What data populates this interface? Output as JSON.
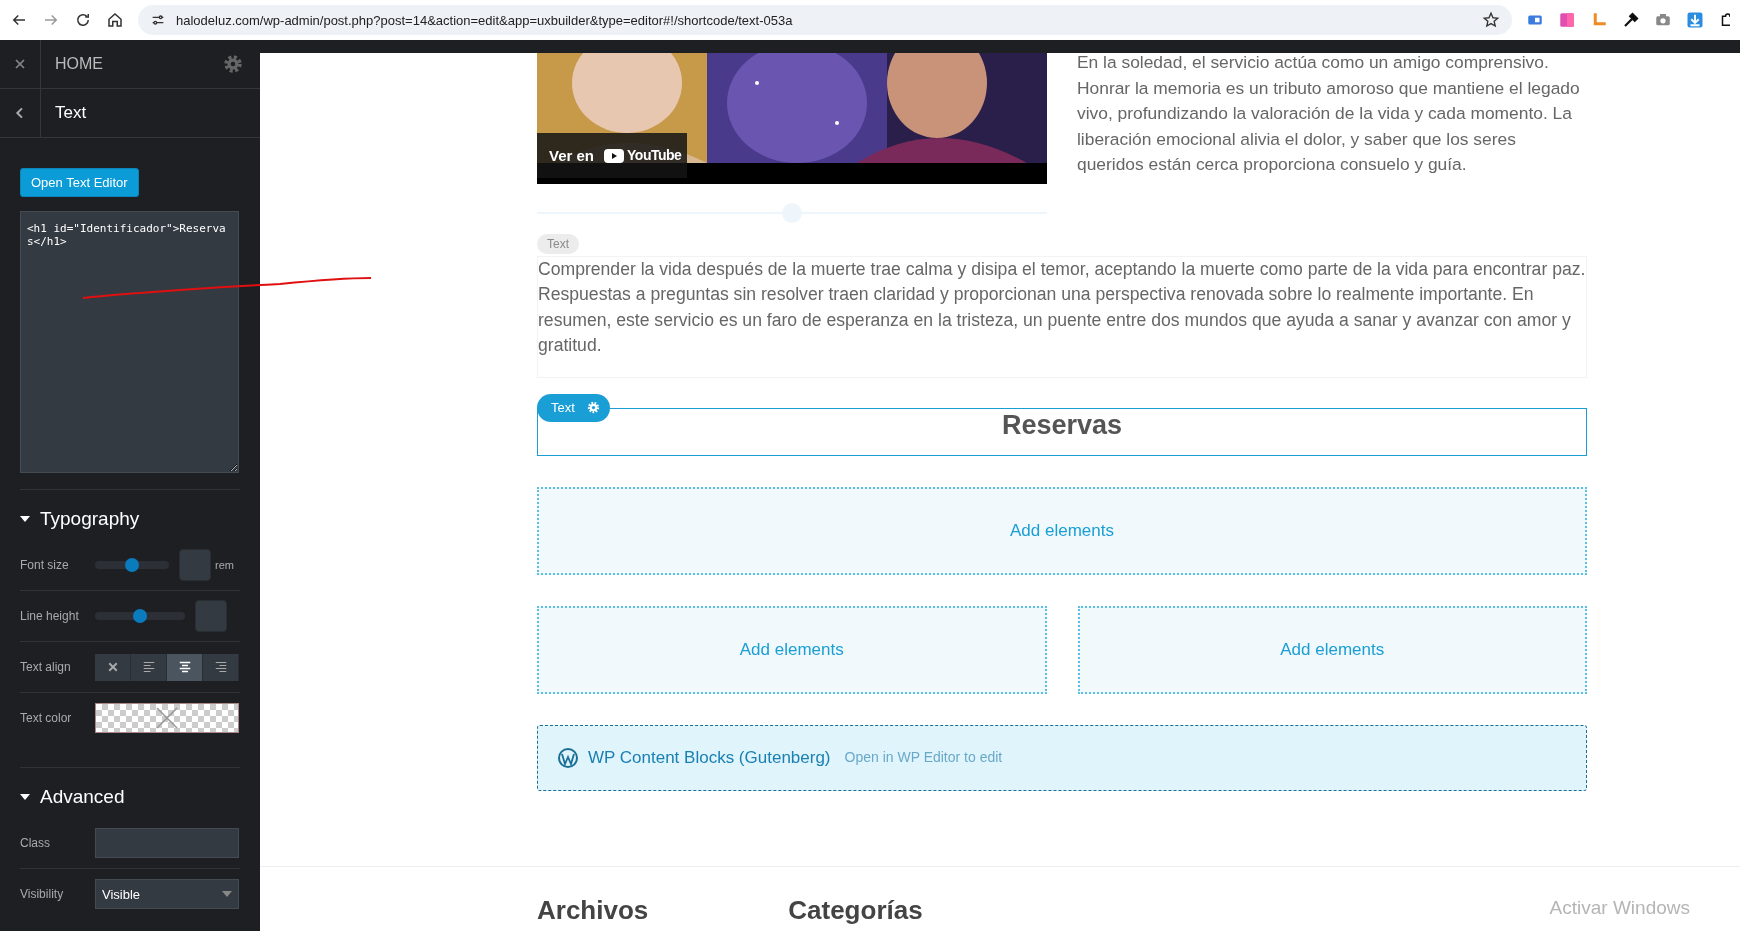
{
  "browser": {
    "url": "halodeluz.com/wp-admin/post.php?post=14&action=edit&app=uxbuilder&type=editor#!/shortcode/text-053a"
  },
  "sidebar": {
    "header_title": "HOME",
    "panel_title": "Text",
    "open_editor_button": "Open Text Editor",
    "code": "<h1 id=\"Identificador\">Reservas</h1>",
    "typography": {
      "title": "Typography",
      "expanded": true,
      "font_size": {
        "label": "Font size",
        "level": 0.5,
        "unit": "rem"
      },
      "line_height": {
        "label": "Line height",
        "level": 0.5
      },
      "text_align": {
        "label": "Text align",
        "options": [
          {
            "kind": "none",
            "selected": false
          },
          {
            "kind": "left",
            "selected": false
          },
          {
            "kind": "center",
            "selected": true
          },
          {
            "kind": "right",
            "selected": false
          }
        ]
      },
      "text_color": {
        "label": "Text color"
      }
    },
    "advanced": {
      "title": "Advanced",
      "expanded": true,
      "class_label": "Class",
      "visibility": {
        "label": "Visibility",
        "value": "Visible"
      }
    }
  },
  "content": {
    "video": {
      "watch_label": "Ver en",
      "logo_text": "YouTube"
    },
    "side_text": "En la soledad, el servicio actúa como un amigo comprensivo. Honrar la memoria es un tributo amoroso que mantiene el legado vivo, profundizando la valoración de la vida y cada momento. La liberación emocional alivia el dolor, y saber que los seres queridos están cerca proporciona consuelo y guía.",
    "ghost_tag": "Text",
    "paragraph": "Comprender la vida después de la muerte trae calma y disipa el temor, aceptando la muerte como parte de la vida para encontrar paz. Respuestas a preguntas sin resolver traen claridad y proporcionan una perspectiva renovada sobre lo realmente importante. En resumen, este servicio es un faro de esperanza en la tristeza, un puente entre dos mundos que ayuda a sanar y avanzar con amor y gratitud.",
    "selected_element": {
      "tag": "Text",
      "heading": "Reservas"
    },
    "add_rows": [
      [
        {
          "label": "Add elements"
        }
      ],
      [
        {
          "label": "Add elements"
        },
        {
          "label": "Add elements"
        }
      ]
    ],
    "wp_block": {
      "title": "WP Content Blocks (Gutenberg)",
      "hint": "Open in WP Editor to edit"
    },
    "footer_headings": [
      "Archivos",
      "Categorías"
    ]
  },
  "os_notice": "Activar Windows"
}
